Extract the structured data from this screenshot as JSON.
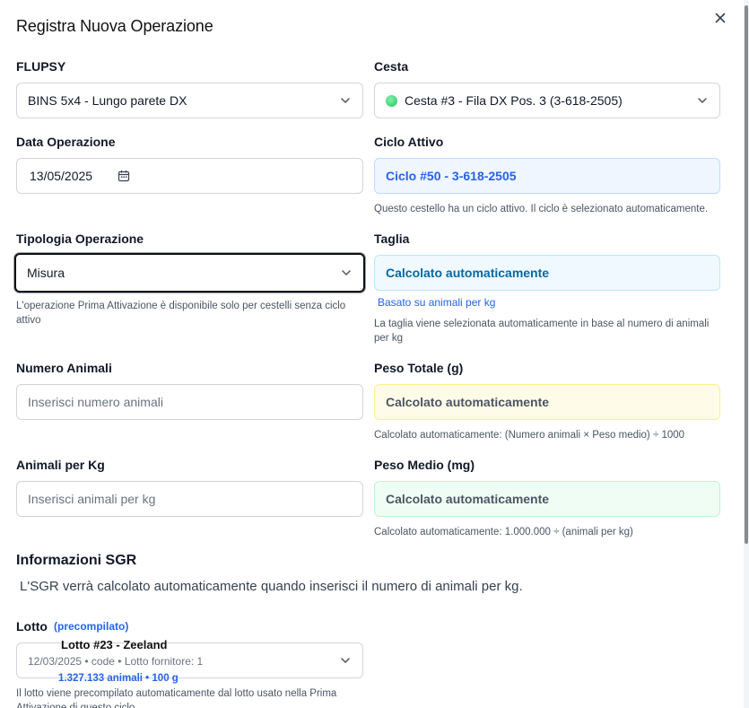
{
  "dialog": {
    "title": "Registra Nuova Operazione"
  },
  "flupsy": {
    "label": "FLUPSY",
    "value": "BINS 5x4 - Lungo parete DX"
  },
  "cesta": {
    "label": "Cesta",
    "value": "Cesta #3 - Fila DX Pos. 3 (3-618-2505)",
    "status_color": "#22c55e"
  },
  "data_operazione": {
    "label": "Data Operazione",
    "value": "13/05/2025"
  },
  "ciclo": {
    "label": "Ciclo Attivo",
    "value": "Ciclo #50 - 3-618-2505",
    "help": "Questo cestello ha un ciclo attivo. Il ciclo è selezionato automaticamente."
  },
  "tipologia": {
    "label": "Tipologia Operazione",
    "value": "Misura",
    "help_line1": "L'operazione Prima Attivazione è disponibile solo per cestelli senza ciclo",
    "help_line2": "attivo"
  },
  "taglia": {
    "label": "Taglia",
    "value": "Calcolato automaticamente",
    "basis": "Basato su animali per kg",
    "help_line1": "La taglia viene selezionata automaticamente in base al numero di animali",
    "help_line2": "per kg"
  },
  "numero_animali": {
    "label": "Numero Animali",
    "placeholder": "Inserisci numero animali"
  },
  "peso_totale": {
    "label": "Peso Totale (g)",
    "value": "Calcolato automaticamente",
    "help": "Calcolato automaticamente: (Numero animali × Peso medio) ÷ 1000"
  },
  "animali_kg": {
    "label": "Animali per Kg",
    "placeholder": "Inserisci animali per kg"
  },
  "peso_medio": {
    "label": "Peso Medio (mg)",
    "value": "Calcolato automaticamente",
    "help": "Calcolato automaticamente: 1.000.000 ÷ (animali per kg)"
  },
  "sgr": {
    "title": "Informazioni SGR",
    "text": "L'SGR verrà calcolato automaticamente quando inserisci il numero di animali per kg."
  },
  "lotto": {
    "label": "Lotto",
    "tag": "(precompilato)",
    "name": "Lotto #23 - Zeeland",
    "meta": "12/03/2025 • code • Lotto fornitore: 1",
    "stats": "1.327.133 animali • 100 g",
    "help_line1": "Il lotto viene precompilato automaticamente dal lotto usato nella Prima",
    "help_line2": "Attivazione di questo ciclo"
  },
  "icons": {
    "close": "close-icon",
    "chevron": "chevron-down-icon",
    "calendar": "calendar-icon"
  }
}
